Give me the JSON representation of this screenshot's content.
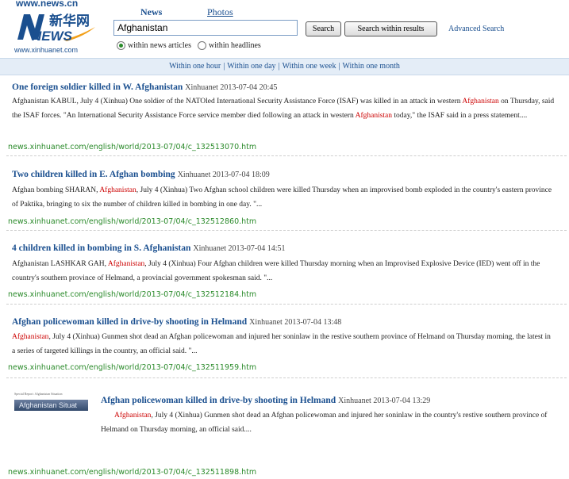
{
  "logo": {
    "site_text": "www.news.cn",
    "cn_text": "新华网",
    "news_text": "NEWS",
    "sub_text": "www.xinhuanet.com"
  },
  "tabs": {
    "news": "News",
    "photos": "Photos"
  },
  "search": {
    "value": "Afghanistan",
    "search_button": "Search",
    "within_button": "Search within results",
    "advanced": "Advanced Search",
    "radio_articles": "within news articles",
    "radio_headlines": "within headlines"
  },
  "time_filters": [
    "Within one hour",
    "Within one day",
    "Within one week",
    "Within one month"
  ],
  "results": [
    {
      "title": "One foreign soldier killed in W. Afghanistan",
      "meta": "Xinhuanet 2013-07-04 20:45",
      "body_pre": "Afghanistan KABUL, July 4 (Xinhua) One soldier of the NATOled International Security Assistance Force (ISAF) was killed in an attack in western ",
      "hl1": "Afghanistan",
      "body_mid": " on Thursday, said the ISAF forces. \"An International Security Assistance Force service member died following an attack in western ",
      "hl2": "Afghanistan",
      "body_post": " today,\" the ISAF said in a press statement....",
      "url": "news.xinhuanet.com/english/world/2013-07/04/c_132513070.htm"
    },
    {
      "title": "Two children killed in E. Afghan bombing",
      "meta": "Xinhuanet 2013-07-04 18:09",
      "body_pre": "Afghan bombing SHARAN, ",
      "hl1": "Afghanistan",
      "body_mid": ", July 4 (Xinhua) Two Afghan school children were killed Thursday when an improvised bomb exploded in the country's eastern province of Paktika, bringing to six the number of children killed in bombing in one day. \"...",
      "url": "news.xinhuanet.com/english/world/2013-07/04/c_132512860.htm"
    },
    {
      "title": "4 children killed in bombing in S. Afghanistan",
      "meta": "Xinhuanet 2013-07-04 14:51",
      "body_pre": "Afghanistan LASHKAR GAH, ",
      "hl1": "Afghanistan",
      "body_mid": ", July 4 (Xinhua) Four Afghan children were killed Thursday morning when an Improvised Explosive Device (IED) went off in the country's southern province of Helmand, a provincial government spokesman said. \"...",
      "url": "news.xinhuanet.com/english/world/2013-07/04/c_132512184.htm"
    },
    {
      "title": "Afghan policewoman killed in drive-by shooting in Helmand",
      "meta": "Xinhuanet 2013-07-04 13:48",
      "hl1": "Afghanistan",
      "body_mid": ", July 4 (Xinhua) Gunmen shot dead an Afghan policewoman and injured her soninlaw in the restive southern province of Helmand on Thursday morning, the latest in a series of targeted killings in the country, an official said. \"...",
      "url": "news.xinhuanet.com/english/world/2013-07/04/c_132511959.htm"
    },
    {
      "title": "Afghan policewoman killed in drive-by shooting in Helmand",
      "meta": "Xinhuanet 2013-07-04 13:29",
      "hl1": "Afghanistan",
      "body_mid": ", July 4 (Xinhua) Gunmen shot dead an Afghan policewoman and injured her soninlaw in the country's restive southern province of Helmand on Thursday morning, an official said....",
      "thumb_caption": "Afghanistan Situat",
      "thumb_small": "Special Report: Afghanistan Situation",
      "url": "news.xinhuanet.com/english/world/2013-07/04/c_132511898.htm"
    }
  ]
}
